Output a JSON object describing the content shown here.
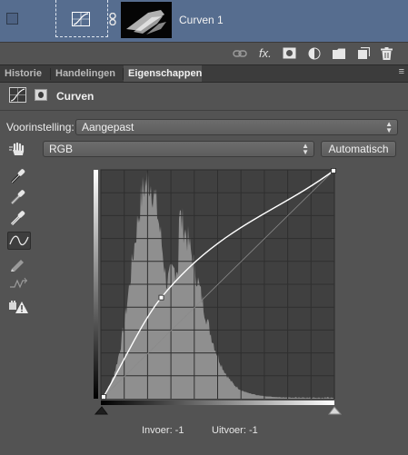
{
  "layer": {
    "name": "Curven 1",
    "visibility_icon": "visibility-checkbox",
    "adjustment_icon": "curves-adjustment-icon",
    "link_icon": "chain-link-icon",
    "mask_thumbnail": "layer-mask-thumbnail",
    "selection_color": "#566d8f"
  },
  "layers_toolbar": {
    "fx_label": "fx.",
    "icons": [
      "link-layers-icon",
      "fx-icon",
      "add-mask-icon",
      "adjustment-layer-icon",
      "group-folder-icon",
      "new-layer-icon",
      "delete-trash-icon"
    ]
  },
  "tabs": [
    {
      "label": "Historie",
      "active": false
    },
    {
      "label": "Handelingen",
      "active": false
    },
    {
      "label": "Eigenschappen",
      "active": true
    }
  ],
  "panel_menu": "≡",
  "properties": {
    "title": "Curven",
    "header_icons": [
      "curves-properties-icon",
      "mask-properties-icon"
    ]
  },
  "preset": {
    "label": "Voorinstelling:",
    "value": "Aangepast"
  },
  "channel": {
    "value": "RGB"
  },
  "auto_button": "Automatisch",
  "tools": [
    "on-image-adjust-hand-icon",
    "black-point-eyedropper-icon",
    "gray-point-eyedropper-icon",
    "white-point-eyedropper-icon",
    "curve-points-tool-icon",
    "pencil-draw-icon",
    "smooth-curve-icon",
    "clipping-warning-icon"
  ],
  "curve": {
    "input_range": [
      0,
      255
    ],
    "output_range": [
      0,
      255
    ],
    "control_points": [
      [
        0,
        0
      ],
      [
        64,
        112
      ],
      [
        255,
        255
      ]
    ],
    "grid_divisions": 10,
    "histogram_color": "#8f8f8f",
    "curve_color": "#ffffff"
  },
  "readout": {
    "input": "Invoer: -1",
    "output": "Uitvoer: -1"
  }
}
